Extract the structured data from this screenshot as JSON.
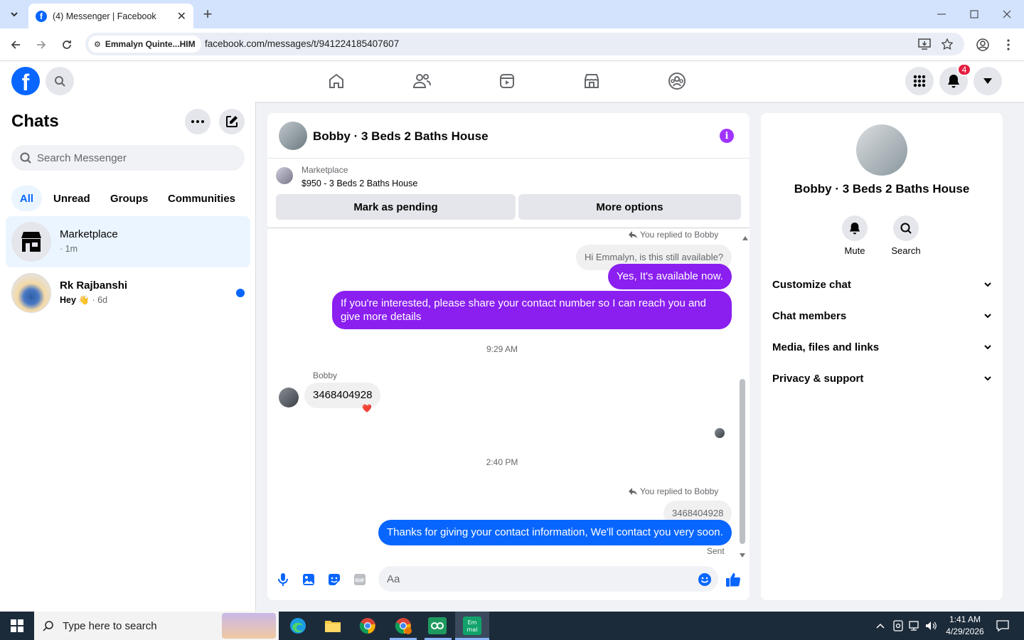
{
  "browser": {
    "tab_title": "(4) Messenger | Facebook",
    "site_chip": "Emmalyn Quinte...HIM",
    "url": "facebook.com/messages/t/941224185407607"
  },
  "fb_header": {
    "notifications_count": "4"
  },
  "chats": {
    "title": "Chats",
    "search_placeholder": "Search Messenger",
    "filters": [
      "All",
      "Unread",
      "Groups",
      "Communities"
    ],
    "items": [
      {
        "name": "Marketplace",
        "sub": "· 1m"
      },
      {
        "name": "Rk Rajbanshi",
        "sub_text": "Hey",
        "sub_emoji": "👋",
        "sub_time": "· 6d"
      }
    ]
  },
  "conversation": {
    "title": "Bobby · 3 Beds 2 Baths House",
    "marketplace_label": "Marketplace",
    "listing": "$950 - 3 Beds 2 Baths House",
    "mark_pending": "Mark as pending",
    "more_options": "More options",
    "reply_label": "You replied to Bobby",
    "quote_1": "Hi Emmalyn, is this still available?",
    "msg_1": "Yes, It's available now.",
    "msg_2": "If you're interested, please share your contact number so I can reach you and give more details",
    "time_1": "9:29 AM",
    "sender": "Bobby",
    "incoming_1": "3468404928",
    "reaction": "❤️",
    "time_2": "2:40 PM",
    "reply_label_2": "You replied to Bobby",
    "quote_2": "3468404928",
    "msg_3": "Thanks for giving your contact information, We'll contact you very soon.",
    "status": "Sent",
    "composer_placeholder": "Aa"
  },
  "details": {
    "name": "Bobby · 3 Beds 2 Baths House",
    "mute": "Mute",
    "search": "Search",
    "sections": [
      "Customize chat",
      "Chat members",
      "Media, files and links",
      "Privacy & support"
    ]
  },
  "taskbar": {
    "search_placeholder": "Type here to search",
    "time": "1:41 AM",
    "date": "4/29/2026"
  },
  "colors": {
    "fb_blue": "#0866ff",
    "purple_bubble": "#8a1ff0",
    "taskbar": "#1c2b3a"
  }
}
